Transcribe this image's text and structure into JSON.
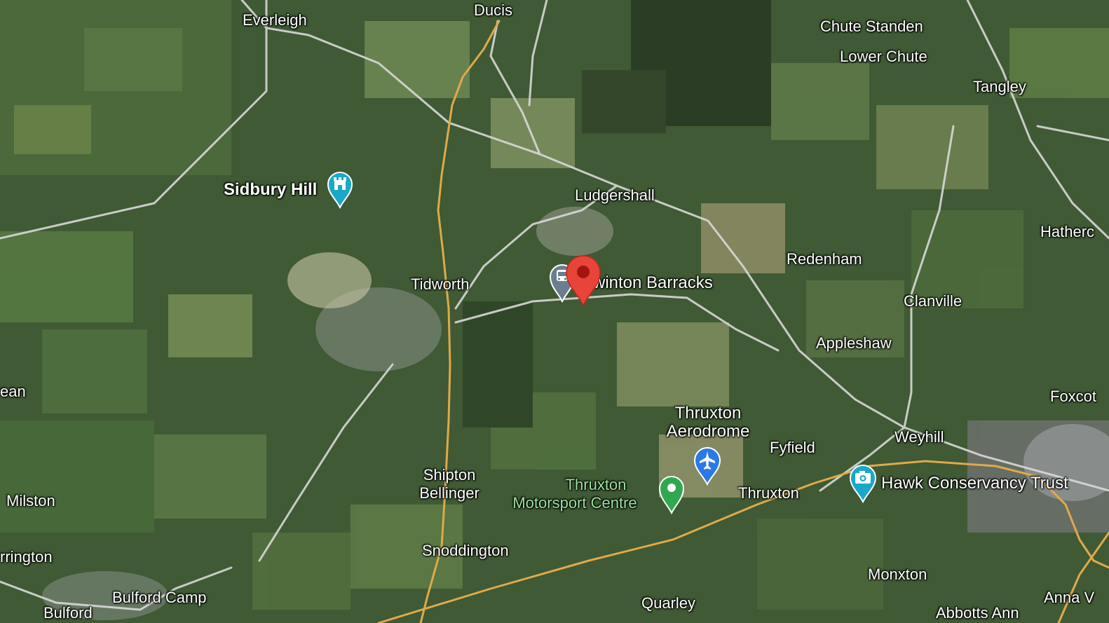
{
  "map": {
    "type": "satellite",
    "colors": {
      "road_minor": "#d8d8d8",
      "road_major": "#e0a94a",
      "pin_red": "#e8443a",
      "pin_teal": "#1aa8c8",
      "pin_blue": "#2979e8",
      "pin_green": "#2fa84f",
      "pin_gray": "#6b7d8f"
    }
  },
  "places": {
    "everleigh": "Everleigh",
    "ducis": "Ducis",
    "chute_standen": "Chute Standen",
    "lower_chute": "Lower Chute",
    "tangley": "Tangley",
    "sidbury_hill": "Sidbury Hill",
    "ludgershall": "Ludgershall",
    "hatherden": "Hatherc",
    "redenham": "Redenham",
    "tidworth": "Tidworth",
    "swinton_barracks": "winton Barracks",
    "clanville": "Clanville",
    "appleshaw": "Appleshaw",
    "ean": "ean",
    "foxcotte": "Foxcot",
    "thruxton_aerodrome_line1": "Thruxton",
    "thruxton_aerodrome_line2": "Aerodrome",
    "fyfield": "Fyfield",
    "weyhill": "Weyhill",
    "shipton_line1": "Shipton",
    "shipton_line2": "Bellinger",
    "motorsport_line1": "Thruxton",
    "motorsport_line2": "Motorsport Centre",
    "thruxton": "Thruxton",
    "hawk_conservancy": "Hawk Conservancy Trust",
    "milston": "Milston",
    "durrington": "rrington",
    "snoddington": "Snoddington",
    "monxton": "Monxton",
    "bulford_camp": "Bulford Camp",
    "bulford": "Bulford",
    "quarley": "Quarley",
    "abbotts_ann": "Abbotts Ann",
    "anna_valley": "Anna V"
  },
  "pins": {
    "sidbury_hill": "castle-icon",
    "train": "train-station-icon",
    "selected": "location-pin-icon",
    "aerodrome": "airport-icon",
    "motorsport": "place-marker-icon",
    "hawk": "camera-icon"
  }
}
